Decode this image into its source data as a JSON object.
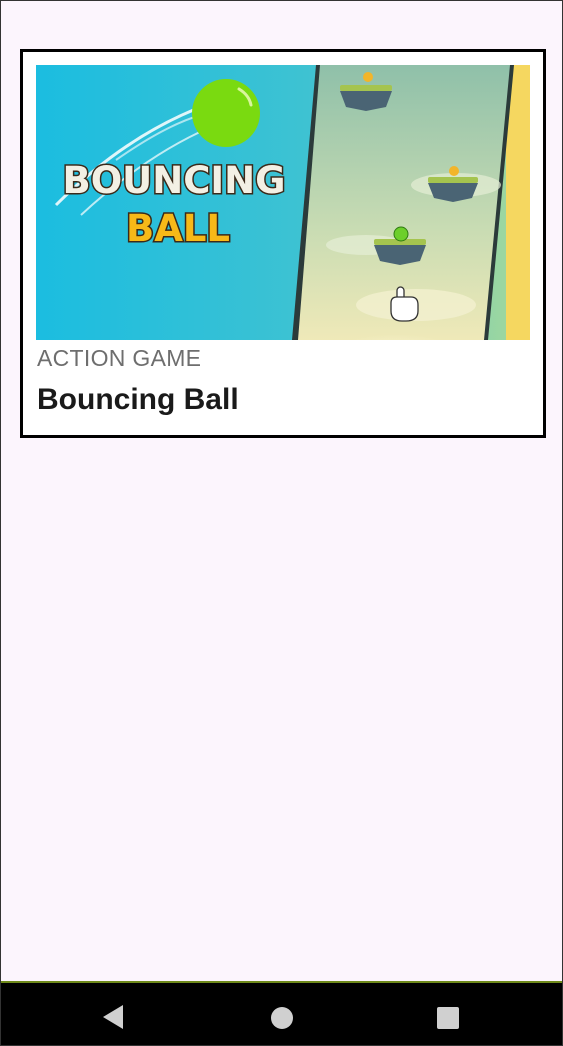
{
  "game_card": {
    "category": "ACTION GAME",
    "title": "Bouncing Ball",
    "thumbnail": {
      "logo_line1": "BOUNCING",
      "logo_line2": "BALL"
    }
  },
  "nav_bar": {
    "back_icon": "back-triangle-icon",
    "home_icon": "home-circle-icon",
    "recents_icon": "recents-square-icon"
  },
  "colors": {
    "background": "#fcf5fd",
    "card_border": "#000000",
    "category_text": "#6e6e6e",
    "title_text": "#1a1a1a",
    "nav_bar": "#000000",
    "ball_green": "#7ada10",
    "logo_yellow": "#f7b918"
  }
}
